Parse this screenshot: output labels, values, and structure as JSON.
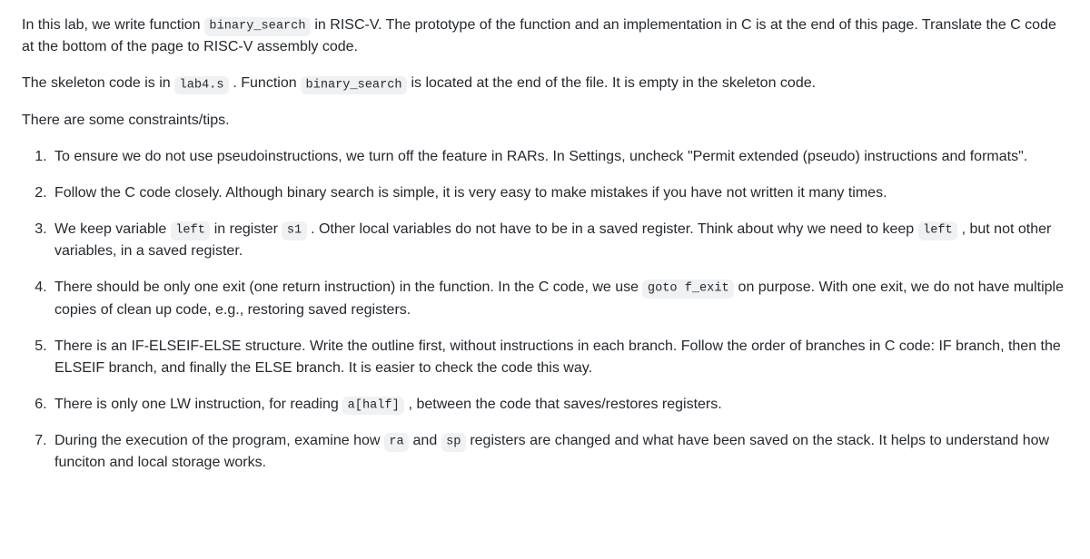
{
  "intro": {
    "p1_pre": "In this lab, we write function ",
    "p1_code1": "binary_search",
    "p1_post": " in RISC-V. The prototype of the function and an implementation in C is at the end of this page. Translate the C code at the bottom of the page to RISC-V assembly code.",
    "p2_pre": "The skeleton code is in ",
    "p2_code1": "lab4.s",
    "p2_mid": " . Function ",
    "p2_code2": "binary_search",
    "p2_post": " is located at the end of the file. It is empty in the skeleton code.",
    "p3": "There are some constraints/tips."
  },
  "list": {
    "item1": "To ensure we do not use pseudoinstructions, we turn off the feature in RARs. In Settings, uncheck \"Permit extended (pseudo) instructions and formats\".",
    "item2": "Follow the C code closely. Although binary search is simple, it is very easy to make mistakes if you have not written it many times.",
    "item3_pre": "We keep variable ",
    "item3_code1": "left",
    "item3_mid1": " in register ",
    "item3_code2": "s1",
    "item3_mid2": " . Other local variables do not have to be in a saved register. Think about why we need to keep ",
    "item3_code3": "left",
    "item3_post": " , but not other variables, in a saved register.",
    "item4_pre": "There should be only one exit (one return instruction) in the function. In the C code, we use ",
    "item4_code1": "goto f_exit",
    "item4_post": " on purpose. With one exit, we do not have multiple copies of clean up code, e.g., restoring saved registers.",
    "item5": "There is an IF-ELSEIF-ELSE structure. Write the outline first, without instructions in each branch. Follow the order of branches in C code: IF branch, then the ELSEIF branch, and finally the ELSE branch. It is easier to check the code this way.",
    "item6_pre": "There is only one LW instruction, for reading ",
    "item6_code1": "a[half]",
    "item6_post": " , between the code that saves/restores registers.",
    "item7_pre": "During the execution of the program, examine how ",
    "item7_code1": "ra",
    "item7_mid": " and ",
    "item7_code2": "sp",
    "item7_post": " registers are changed and what have been saved on the stack. It helps to understand how funciton and local storage works."
  }
}
